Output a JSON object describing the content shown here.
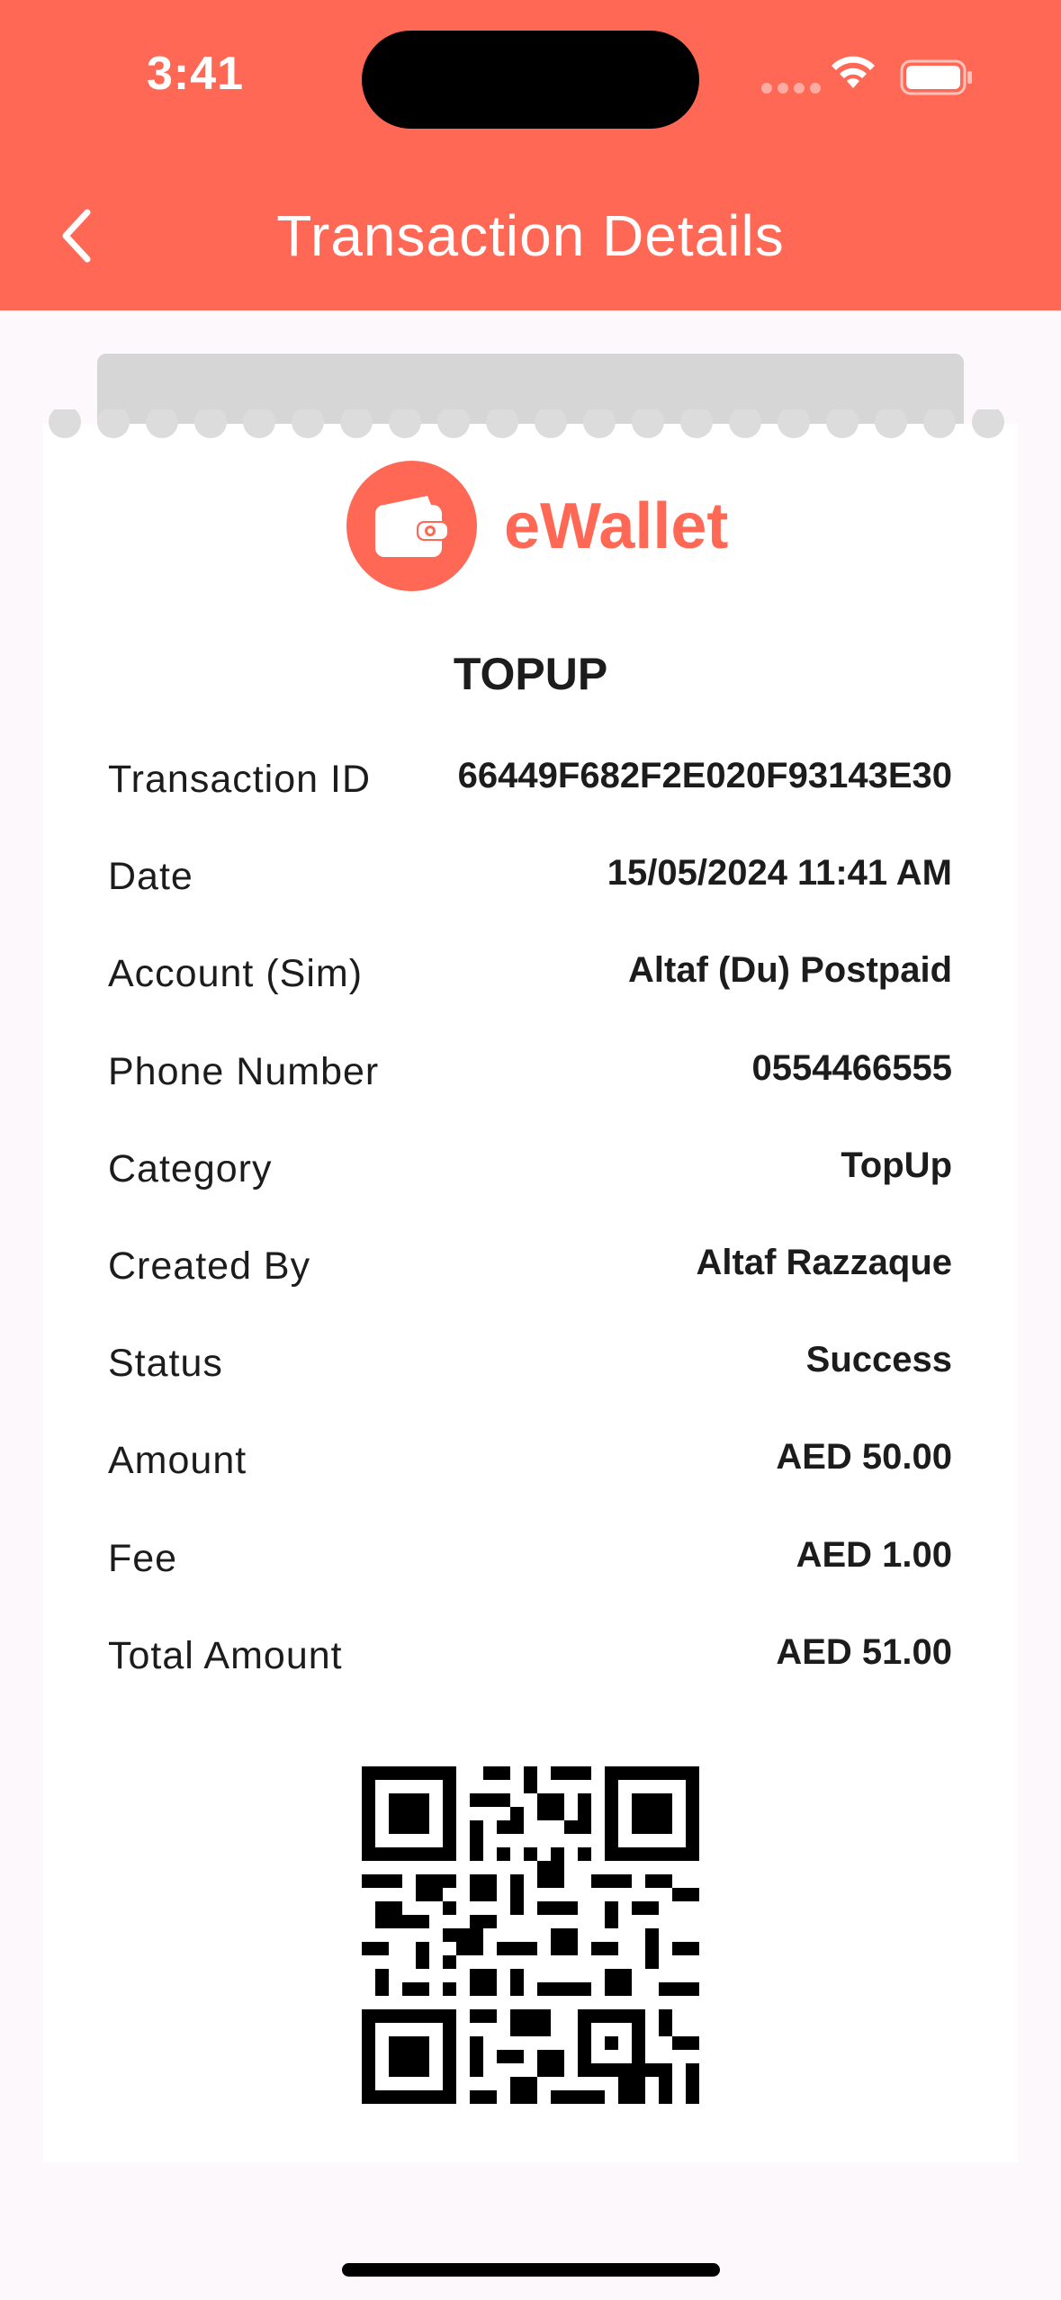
{
  "status_bar": {
    "time": "3:41"
  },
  "header": {
    "title": "Transaction Details",
    "back_icon": "chevron-left-icon",
    "background_color": "#fe6855"
  },
  "receipt": {
    "brand_name": "eWallet",
    "brand_icon": "wallet-icon",
    "brand_color": "#fe6855",
    "transaction_type": "TOPUP",
    "details": [
      {
        "label": "Transaction ID",
        "value": "66449F682F2E020F93143E30"
      },
      {
        "label": "Date",
        "value": "15/05/2024 11:41 AM"
      },
      {
        "label": "Account (Sim)",
        "value": "Altaf (Du) Postpaid"
      },
      {
        "label": "Phone Number",
        "value": "0554466555"
      },
      {
        "label": "Category",
        "value": "TopUp"
      },
      {
        "label": "Created By",
        "value": "Altaf Razzaque"
      },
      {
        "label": "Status",
        "value": "Success"
      },
      {
        "label": "Amount",
        "value": "AED 50.00"
      },
      {
        "label": "Fee",
        "value": "AED 1.00"
      },
      {
        "label": "Total Amount",
        "value": "AED 51.00"
      }
    ],
    "qr_icon": "qr-code"
  }
}
